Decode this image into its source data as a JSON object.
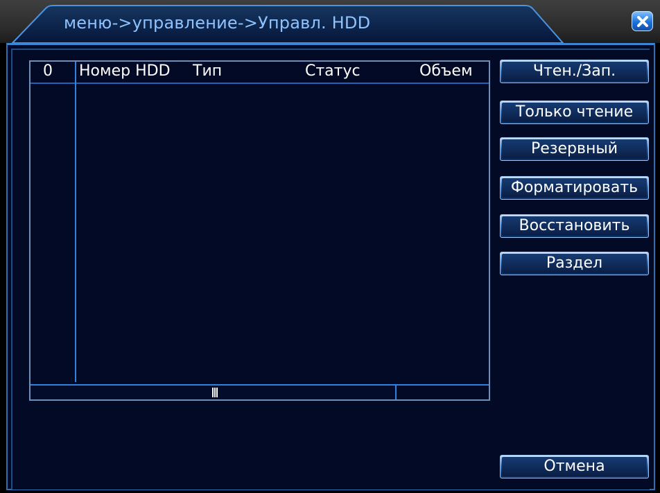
{
  "window": {
    "title": "меню->управление->Управл. HDD",
    "close_icon": "close-icon",
    "accent_color": "#2e82e0"
  },
  "table": {
    "headers": {
      "index": "0",
      "number": "Номер HDD",
      "type": "Тип",
      "status": "Статус",
      "size": "Объем"
    },
    "rows": []
  },
  "buttons": {
    "read_write": "Чтен./Зап.",
    "read_only": "Только чтение",
    "redundant": "Резервный",
    "format": "Форматировать",
    "recover": "Восстановить",
    "partition": "Раздел",
    "cancel": "Отмена"
  }
}
